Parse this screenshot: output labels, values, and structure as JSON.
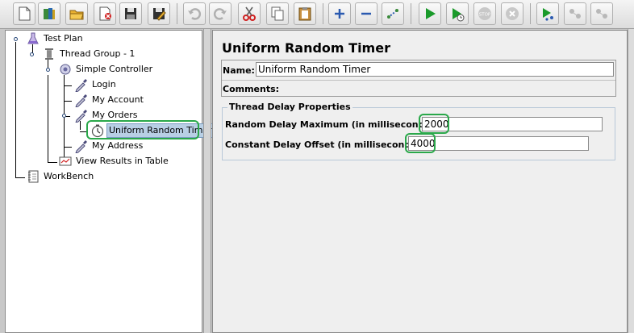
{
  "toolbar": {
    "buttons": [
      {
        "name": "new-icon"
      },
      {
        "name": "templates-icon"
      },
      {
        "name": "open-icon"
      },
      {
        "name": "close-icon"
      },
      {
        "name": "save-icon"
      },
      {
        "name": "save-as-icon"
      },
      {
        "name": "undo-icon"
      },
      {
        "name": "redo-icon"
      },
      {
        "name": "cut-icon"
      },
      {
        "name": "copy-icon"
      },
      {
        "name": "paste-icon"
      },
      {
        "name": "expand-icon"
      },
      {
        "name": "collapse-icon"
      },
      {
        "name": "toggle-icon"
      },
      {
        "name": "start-icon"
      },
      {
        "name": "start-no-timers-icon"
      },
      {
        "name": "stop-icon"
      },
      {
        "name": "shutdown-icon"
      },
      {
        "name": "remote-start-icon"
      },
      {
        "name": "remote-stop-icon"
      },
      {
        "name": "remote-shutdown-icon"
      }
    ],
    "stop_text": "STOP"
  },
  "tree": {
    "items": [
      {
        "label": "Test Plan"
      },
      {
        "label": "Thread Group - 1"
      },
      {
        "label": "Simple Controller"
      },
      {
        "label": "Login"
      },
      {
        "label": "My Account"
      },
      {
        "label": "My Orders"
      },
      {
        "label": "Uniform Random Timer"
      },
      {
        "label": "My Address"
      },
      {
        "label": "View Results in Table"
      },
      {
        "label": "WorkBench"
      }
    ]
  },
  "panel": {
    "title": "Uniform Random Timer",
    "name_label": "Name:",
    "name_value": "Uniform Random Timer",
    "comments_label": "Comments:",
    "group_title": "Thread Delay Properties",
    "random_delay_label": "Random Delay Maximum (in milliseconds):",
    "random_delay_value": "2000",
    "constant_delay_label": "Constant Delay Offset (in milliseconds):",
    "constant_delay_value": "4000"
  },
  "colors": {
    "highlight": "#2aa84a",
    "selection": "#b8cfe5"
  }
}
